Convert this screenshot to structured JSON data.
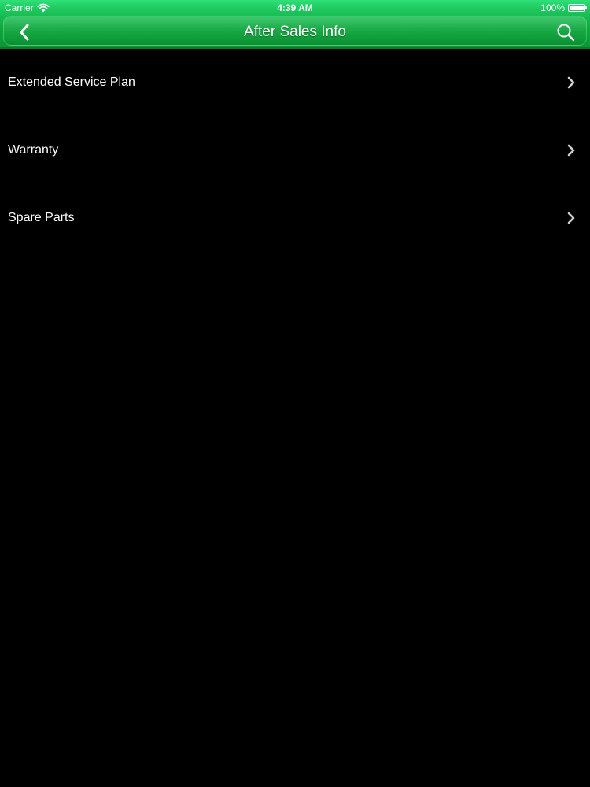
{
  "status_bar": {
    "carrier": "Carrier",
    "time": "4:39 AM",
    "battery": "100%"
  },
  "header": {
    "title": "After Sales Info",
    "back_icon": "chevron-left-icon",
    "search_icon": "search-icon",
    "accent_color": "#16b84a"
  },
  "menu": {
    "items": [
      {
        "label": "Extended Service Plan"
      },
      {
        "label": "Warranty"
      },
      {
        "label": "Spare Parts"
      }
    ]
  }
}
